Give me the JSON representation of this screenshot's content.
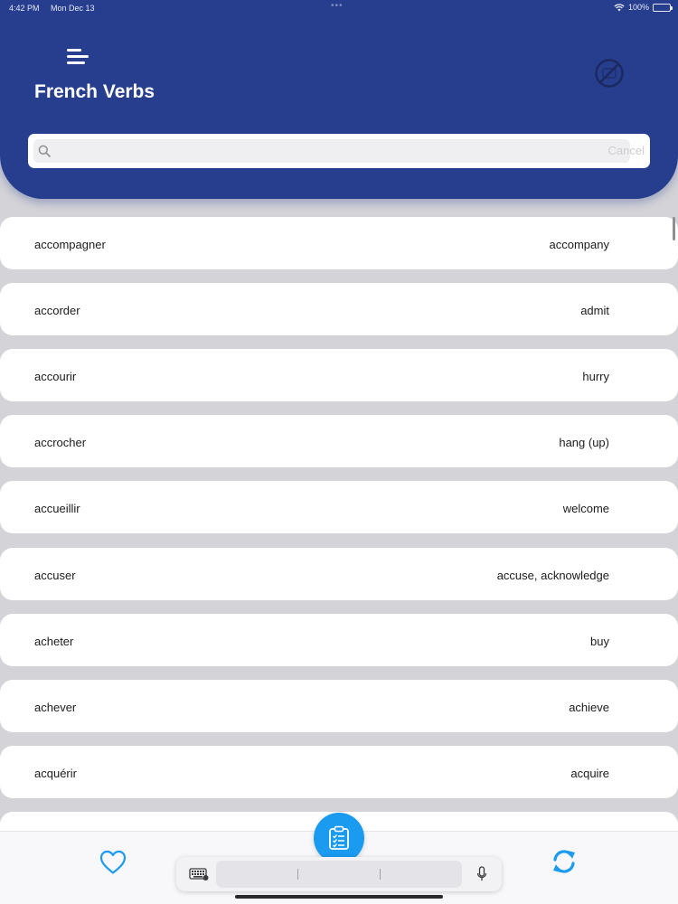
{
  "status_bar": {
    "time": "4:42 PM",
    "date": "Mon Dec 13",
    "battery": "100%"
  },
  "header": {
    "title": "French Verbs",
    "background_color": "#263e8d",
    "menu_icon": "menu-icon",
    "ads_icon": "no-ads-icon"
  },
  "search": {
    "placeholder": "",
    "value": "",
    "cancel_label": "Cancel"
  },
  "verbs": [
    {
      "french": "accompagner",
      "english": "accompany"
    },
    {
      "french": "accorder",
      "english": "admit"
    },
    {
      "french": "accourir",
      "english": "hurry"
    },
    {
      "french": "accrocher",
      "english": "hang (up)"
    },
    {
      "french": "accueillir",
      "english": "welcome"
    },
    {
      "french": "accuser",
      "english": "accuse, acknowledge"
    },
    {
      "french": "acheter",
      "english": "buy"
    },
    {
      "french": "achever",
      "english": "achieve"
    },
    {
      "french": "acquérir",
      "english": "acquire"
    },
    {
      "french": "",
      "english": ""
    }
  ],
  "bottom_bar": {
    "left_icon": "heart-icon",
    "center_icon": "clipboard-icon",
    "right_icon": "refresh-icon",
    "accent_color": "#1a9bf0"
  },
  "keyboard_bar": {
    "left_icon": "keyboard-icon",
    "right_icon": "microphone-icon"
  }
}
